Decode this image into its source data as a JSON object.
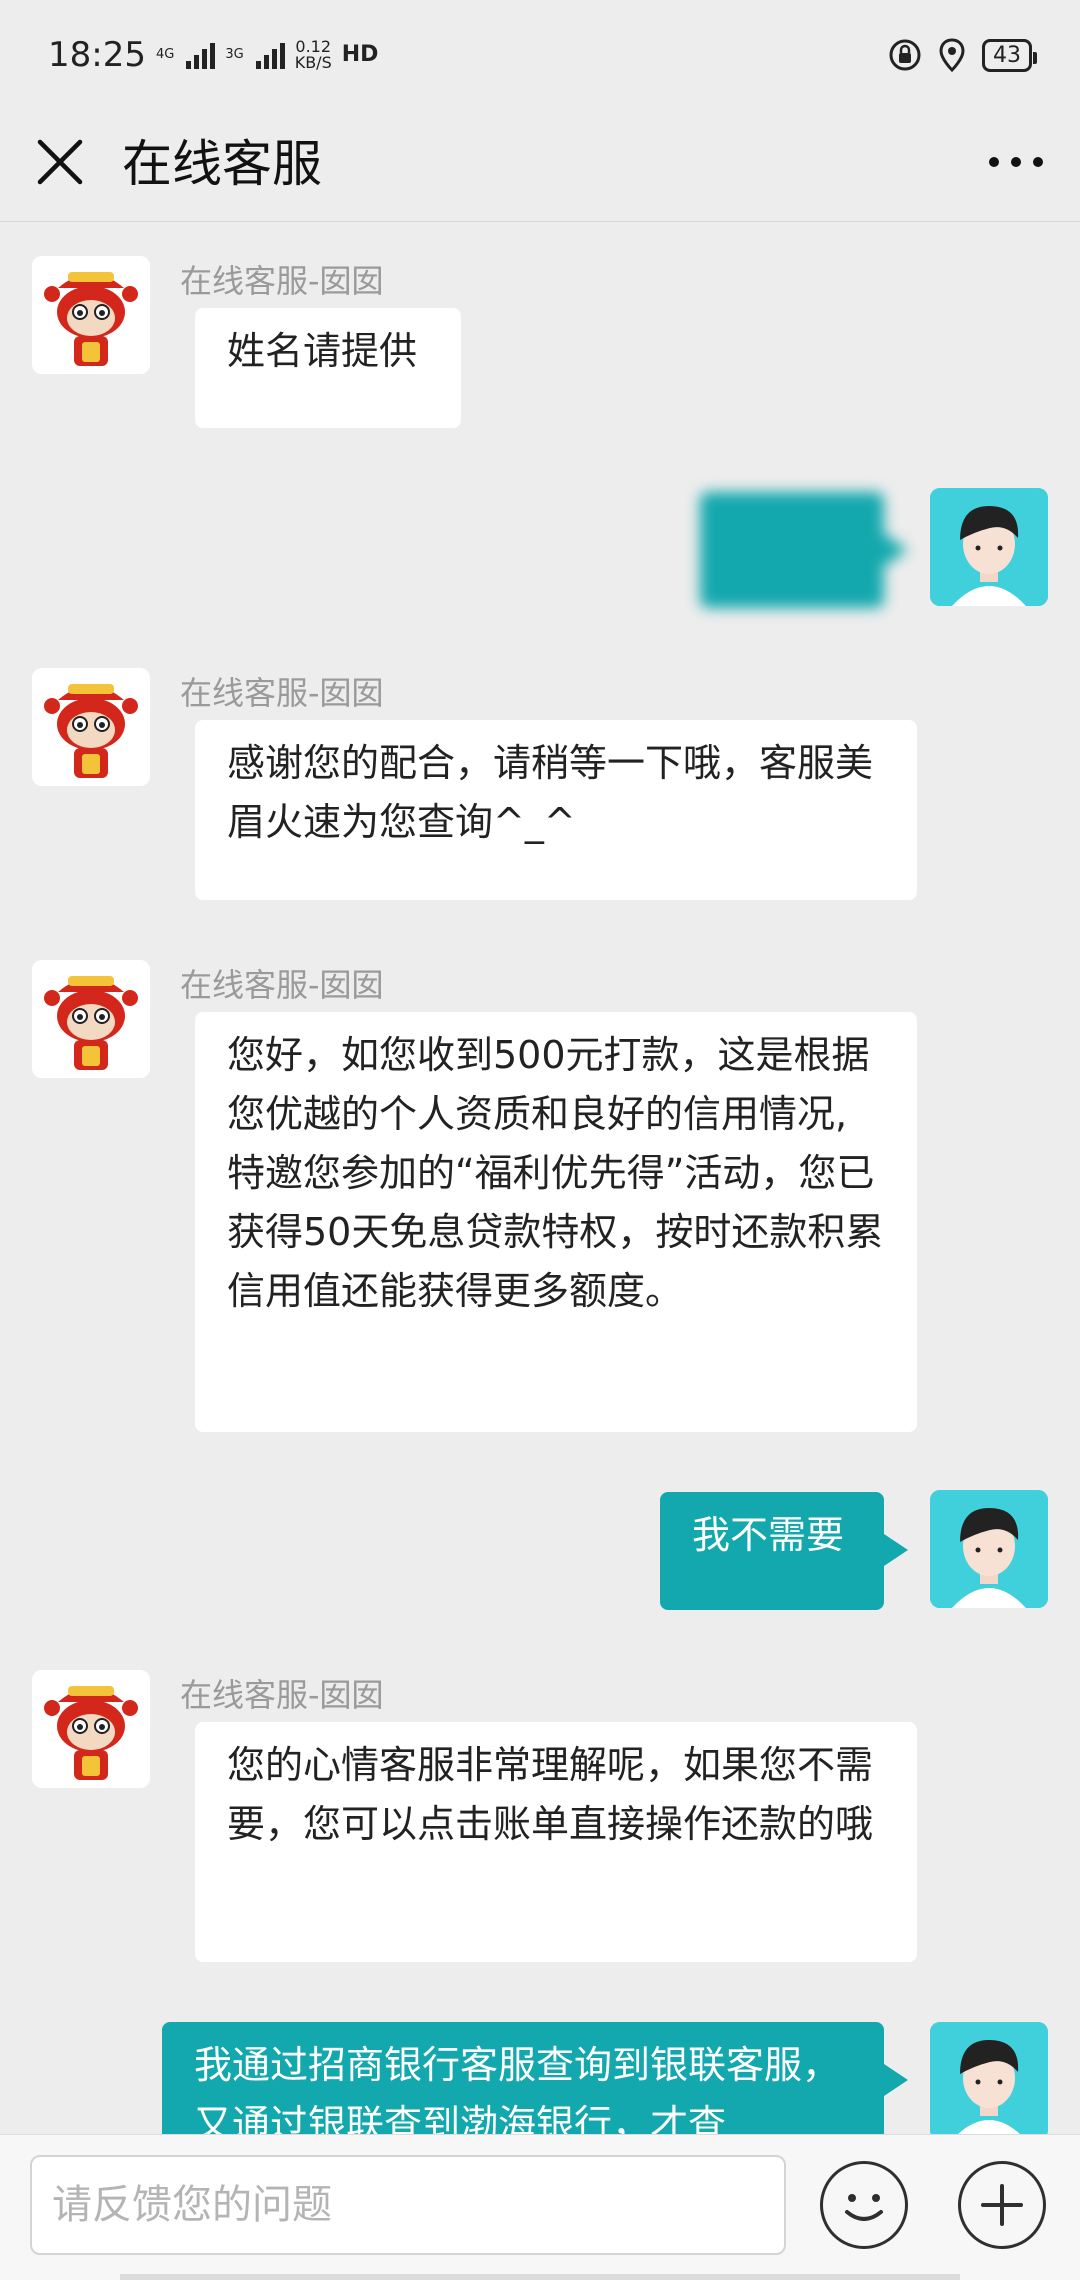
{
  "status_bar": {
    "time": "18:25",
    "network1_top": "4G",
    "network1_bottom": "",
    "network2_top": "3G",
    "speed_top": "0.12",
    "speed_bottom": "KB/S",
    "hd_label": "HD",
    "battery": "43",
    "icons": [
      "signal-icon",
      "lock-rotation-icon",
      "location-icon",
      "battery-icon"
    ]
  },
  "header": {
    "title": "在线客服",
    "close_icon": "close-icon",
    "more_icon": "more-icon"
  },
  "messages": [
    {
      "from": "agent",
      "sender": "在线客服-囡囡",
      "text": "姓名请提供"
    },
    {
      "from": "user",
      "text": "",
      "blurred": true
    },
    {
      "from": "agent",
      "sender": "在线客服-囡囡",
      "text": "感谢您的配合，请稍等一下哦，客服美眉火速为您查询^_^"
    },
    {
      "from": "agent",
      "sender": "在线客服-囡囡",
      "text": "您好，如您收到500元打款，这是根据您优越的个人资质和良好的信用情况,特邀您参加的“福利优先得”活动，您已获得50天免息贷款特权，按时还款积累信用值还能获得更多额度。"
    },
    {
      "from": "user",
      "text": "我不需要"
    },
    {
      "from": "agent",
      "sender": "在线客服-囡囡",
      "text": "您的心情客服非常理解呢，如果您不需要，您可以点击账单直接操作还款的哦"
    },
    {
      "from": "user",
      "text": "我通过招商银行客服查询到银联客服，又通过银联查到渤海银行，才查"
    }
  ],
  "input": {
    "placeholder": "请反馈您的问题",
    "value": ""
  },
  "colors": {
    "background": "#ededed",
    "user_bubble": "#13a8ad",
    "agent_bubble": "#ffffff",
    "sender_name": "#9a9a9a",
    "user_avatar_bg": "#3fd0dc",
    "agent_avatar_accent": "#d4271c"
  }
}
